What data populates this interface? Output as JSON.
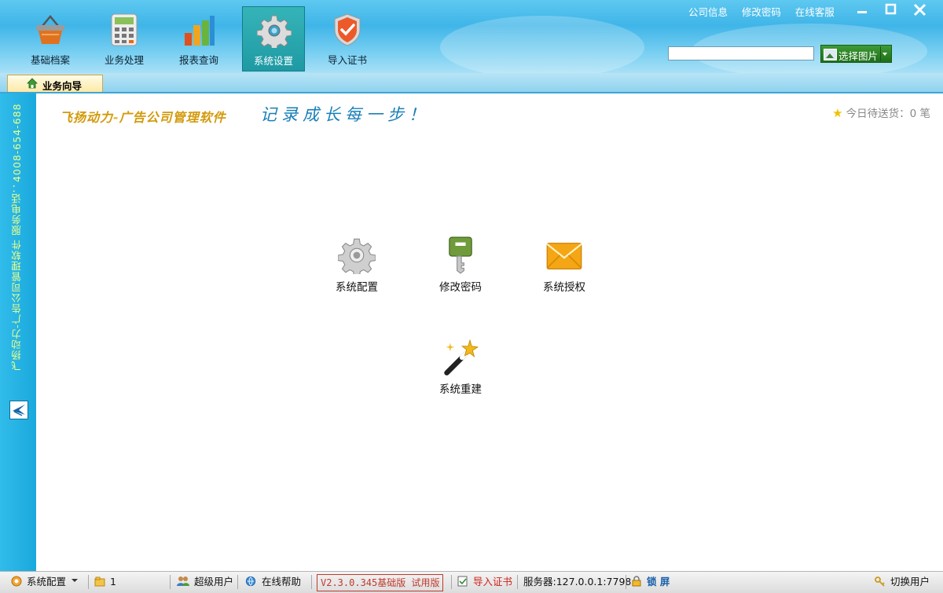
{
  "toolbar": {
    "items": [
      {
        "label": "基础档案",
        "icon": "basket-icon"
      },
      {
        "label": "业务处理",
        "icon": "calculator-icon"
      },
      {
        "label": "报表查询",
        "icon": "bar-chart-icon"
      },
      {
        "label": "系统设置",
        "icon": "gear-icon",
        "active": true
      },
      {
        "label": "导入证书",
        "icon": "shield-check-icon"
      }
    ]
  },
  "top_links": {
    "company_info": "公司信息",
    "change_password": "修改密码",
    "online_support": "在线客服"
  },
  "search": {
    "value": "",
    "placeholder": ""
  },
  "pick_image": {
    "label": "选择图片"
  },
  "tabs": [
    {
      "label": "业务向导",
      "active": true
    }
  ],
  "sidebar": {
    "vertical_text": "飞扬动力-广告公司管理软件    服务电话：4008-654-688"
  },
  "header": {
    "brand_left": "飞扬动力",
    "brand_sep": "-",
    "brand_right": "广告公司管理软件",
    "slogan": "记录成长每一步！",
    "pending_label": "今日待送货：0 笔"
  },
  "functions": [
    {
      "label": "系统配置",
      "icon": "gear-icon"
    },
    {
      "label": "修改密码",
      "icon": "key-icon"
    },
    {
      "label": "系统授权",
      "icon": "envelope-icon"
    },
    {
      "label": "系统重建",
      "icon": "magic-wand-icon"
    }
  ],
  "statusbar": {
    "module": "系统配置",
    "count": "1",
    "user": "超级用户",
    "help": "在线帮助",
    "version": "V2.3.0.345基础版 试用版",
    "import_cert": "导入证书",
    "server": "服务器:127.0.0.1:7798",
    "lock": "锁 屏",
    "switch_user": "切换用户"
  },
  "colors": {
    "accent": "#3fb5e8",
    "active_tool": "#1f9aa4",
    "brand": "#d29a0c",
    "slogan": "#1a7fb8",
    "danger": "#d0231c"
  }
}
